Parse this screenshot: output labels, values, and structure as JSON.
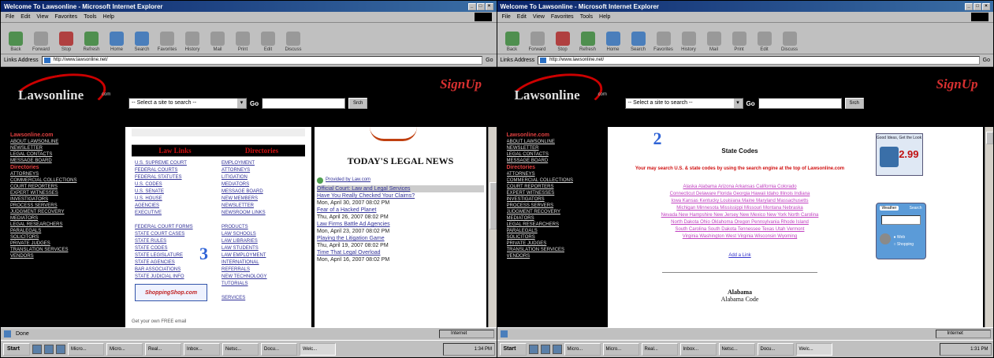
{
  "screens": [
    {
      "browser": {
        "title": "Welcome To Lawsonline - Microsoft Internet Explorer",
        "menu": [
          "File",
          "Edit",
          "View",
          "Favorites",
          "Tools",
          "Help"
        ],
        "toolbar": [
          "Back",
          "Forward",
          "Stop",
          "Refresh",
          "Home",
          "Search",
          "Favorites",
          "History",
          "Mail",
          "Print",
          "Edit",
          "Discuss"
        ],
        "address_label": "Links  Address",
        "address_value": "http://www.lawsonline.net/",
        "go_label": "Go",
        "status": "Done",
        "zone": "Internet"
      },
      "site": {
        "logo": "Lawsonline",
        "logo_tm": "com",
        "signup": "SignUp",
        "search_select": "-- Select a site to search --",
        "search_go": "Go",
        "search_button": "Srch"
      },
      "leftnav": {
        "section1": "Lawsonline.com",
        "links1": [
          "ABOUT LAWSONLINE",
          "NEWSLETTER",
          "LEGAL CONTACTS",
          "MESSAGE BOARD"
        ],
        "section2": "Directories",
        "links2": [
          "ATTORNEYS",
          "COMMERCIAL COLLECTIONS",
          "COURT REPORTERS",
          "EXPERT WITNESSES",
          "INVESTIGATORS",
          "PROCESS SERVERS",
          "JUDGMENT RECOVERY",
          "MEDIATORS",
          "LEGAL RESEARCHERS",
          "PARALEGALS",
          "SOLICITORS",
          "PRIVATE JUDGES",
          "TRANSLATION SERVICES",
          "VENDORS"
        ]
      },
      "left_panel": {
        "col1_head": "Law Links",
        "col2_head": "Directories",
        "col1_links": [
          "U.S. SUPREME COURT",
          "FEDERAL COURTS",
          "FEDERAL STATUTES",
          "U.S. CODES",
          "U.S. SENATE",
          "U.S. HOUSE",
          "AGENCIES",
          "EXECUTIVE",
          "",
          "FEDERAL COURT FORMS",
          "STATE COURT CASES",
          "STATE RULES",
          "STATE CODES",
          "STATE LEGISLATURE",
          "STATE AGENCIES",
          "BAR ASSOCIATIONS",
          "STATE JUDICIAL INFO"
        ],
        "col2_links": [
          "EMPLOYMENT",
          "ATTORNEYS",
          "LITIGATION",
          "MEDIATORS",
          "MESSAGE BOARD",
          "NEW MEMBERS",
          "NEWSLETTER",
          "NEWSROOM LINKS",
          "",
          "PRODUCTS",
          "LAW SCHOOLS",
          "LAW LIBRARIES",
          "LAW STUDENTS",
          "LAW EMPLOYMENT",
          "INTERNATIONAL",
          "REFERRALS",
          "NEW TECHNOLOGY",
          "TUTORIALS",
          "",
          "SERVICES"
        ],
        "ad_label": "ShoppingShop.com",
        "footer": "Get your own FREE email"
      },
      "news": {
        "title": "TODAY'S LEGAL NEWS",
        "subscribe": "Provided by Law.com",
        "items": [
          {
            "headline": "Official Court: Law and Legal Services",
            "date": ""
          },
          {
            "headline": "Have You Really Checked Your Claims?",
            "date": "Mon, April 30, 2007 08:02 PM"
          },
          {
            "headline": "Fear of a Hacked Planet",
            "date": "Thu, April 26, 2007 08:02 PM"
          },
          {
            "headline": "Law Firms Battle Ad Agencies",
            "date": "Mon, April 23, 2007 08:02 PM"
          },
          {
            "headline": "Playing the Litigation Game",
            "date": "Thu, April 19, 2007 08:02 PM"
          },
          {
            "headline": "Time That Legal Overload",
            "date": "Mon, April 16, 2007 08:02 PM"
          }
        ]
      },
      "overlay_label": "3"
    },
    {
      "browser": {
        "title": "Welcome To Lawsonline - Microsoft Internet Explorer",
        "menu": [
          "File",
          "Edit",
          "View",
          "Favorites",
          "Tools",
          "Help"
        ],
        "toolbar": [
          "Back",
          "Forward",
          "Stop",
          "Refresh",
          "Home",
          "Search",
          "Favorites",
          "History",
          "Mail",
          "Print",
          "Edit",
          "Discuss"
        ],
        "address_label": "Links  Address",
        "address_value": "http://www.lawsonline.net/",
        "go_label": "Go",
        "status": "",
        "zone": "Internet"
      },
      "site": {
        "logo": "Lawsonline",
        "logo_tm": "com",
        "signup": "SignUp",
        "search_select": "-- Select a site to search --",
        "search_go": "Go",
        "search_button": "Srch"
      },
      "leftnav": {
        "section1": "Lawsonline.com",
        "links1": [
          "ABOUT LAWSONLINE",
          "NEWSLETTER",
          "LEGAL CONTACTS",
          "MESSAGE BOARD"
        ],
        "section2": "Directories",
        "links2": [
          "ATTORNEYS",
          "COMMERCIAL COLLECTIONS",
          "COURT REPORTERS",
          "EXPERT WITNESSES",
          "INVESTIGATORS",
          "PROCESS SERVERS",
          "JUDGMENT RECOVERY",
          "MEDIATORS",
          "LEGAL RESEARCHERS",
          "PARALEGALS",
          "SOLICITORS",
          "PRIVATE JUDGES",
          "TRANSLATION SERVICES",
          "VENDORS"
        ]
      },
      "state_codes": {
        "title": "State Codes",
        "note": "Your may search U.S. & state codes by using the search engine at the top of Lawsonline.com",
        "state_lines": [
          "Alaska  Alabama  Arizona  Arkansas  California  Colorado",
          "Connecticut  Delaware  Florida  Georgia  Hawaii  Idaho  Illinois  Indiana",
          "Iowa  Kansas  Kentucky  Louisiana  Maine  Maryland  Massachusetts",
          "Michigan  Minnesota  Mississippi  Missouri  Montana  Nebraska",
          "Nevada  New Hampshire  New Jersey  New Mexico  New York  North Carolina",
          "North Dakota  Ohio  Oklahoma  Oregon  Pennsylvania  Rhode Island",
          "South Carolina  South Dakota  Tennessee  Texas  Utah  Vermont",
          "Virginia  Washington  West Virginia  Wisconsin  Wyoming"
        ],
        "add_link": "Add a Link",
        "section_head": "Alabama",
        "section_sub": "Alabama Code"
      },
      "ads": {
        "price_label": "2.99",
        "price_tag": "Good Ideas, Get the Look",
        "weather_tab": "Weather",
        "weather_search": "Search",
        "radio1": "Web",
        "radio2": "Shopping"
      },
      "overlay_label": "2"
    }
  ]
}
